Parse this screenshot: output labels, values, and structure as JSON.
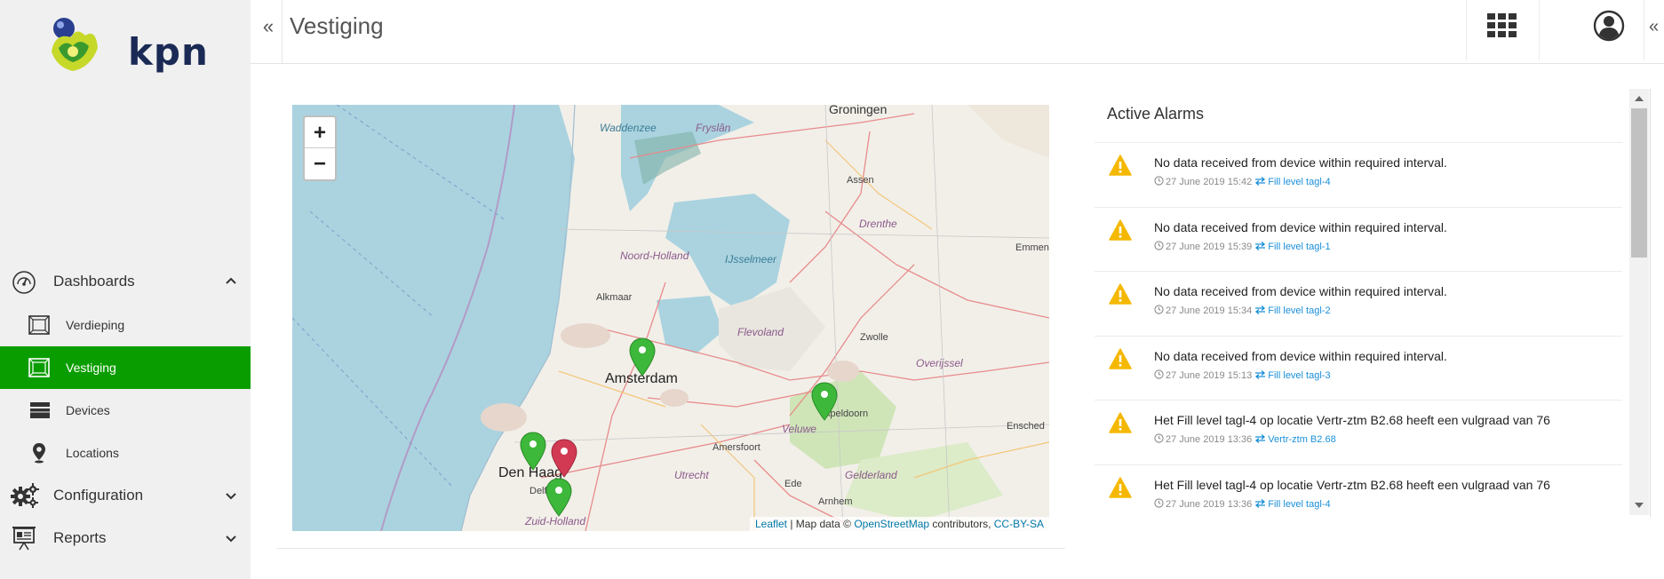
{
  "brand": {
    "name": "kpn",
    "accent": "#0a9d00",
    "dark": "#1b2a55"
  },
  "sidebar": {
    "sections": [
      {
        "label": "Dashboards",
        "icon": "speedometer-icon",
        "expanded": true
      },
      {
        "label": "Configuration",
        "icon": "gears-icon",
        "expanded": false
      },
      {
        "label": "Reports",
        "icon": "presentation-icon",
        "expanded": false
      }
    ],
    "dashboard_items": [
      {
        "label": "Verdieping",
        "icon": "floorplan-icon",
        "active": false
      },
      {
        "label": "Vestiging",
        "icon": "floorplan-icon",
        "active": true
      },
      {
        "label": "Devices",
        "icon": "devices-icon",
        "active": false
      },
      {
        "label": "Locations",
        "icon": "location-pin-icon",
        "active": false
      }
    ]
  },
  "header": {
    "title": "Vestiging",
    "collapse_left": "«",
    "collapse_right": "«",
    "apps_icon": "apps-grid-icon",
    "user_icon": "user-circle-icon"
  },
  "map": {
    "zoom_in": "+",
    "zoom_out": "−",
    "attribution": {
      "leaflet": "Leaflet",
      "sep": " | Map data © ",
      "osm": "OpenStreetMap",
      "contrib": " contributors, ",
      "license": "CC-BY-SA"
    },
    "labels": {
      "groningen": "Groningen",
      "waddenzee": "Waddenzee",
      "fryslan": "Fryslân",
      "assen": "Assen",
      "drenthe": "Drenthe",
      "emmen": "Emmen",
      "noord_holland": "Noord-Holland",
      "ijsselmeer": "IJsselmeer",
      "alkmaar": "Alkmaar",
      "flevoland": "Flevoland",
      "zwolle": "Zwolle",
      "overijssel": "Overijssel",
      "amsterdam": "Amsterdam",
      "apeldoorn": "Apeldoorn",
      "veluwe": "Veluwe",
      "enschede": "Ensched",
      "amersfoort": "Amersfoort",
      "den_haag": "Den Haag",
      "delft": "Delft",
      "utrecht": "Utrecht",
      "ede": "Ede",
      "gelderland": "Gelderland",
      "arnhem": "Arnhem",
      "zuid_holland": "Zuid-Holland"
    },
    "marker_colors": {
      "ok": "#3db83a",
      "alarm": "#d23a53"
    }
  },
  "alarms": {
    "title": "Active Alarms",
    "items": [
      {
        "message": "No data received from device within required interval.",
        "time": "27 June 2019 15:42",
        "link": "Fill level tagl-4"
      },
      {
        "message": "No data received from device within required interval.",
        "time": "27 June 2019 15:39",
        "link": "Fill level tagl-1"
      },
      {
        "message": "No data received from device within required interval.",
        "time": "27 June 2019 15:34",
        "link": "Fill level tagl-2"
      },
      {
        "message": "No data received from device within required interval.",
        "time": "27 June 2019 15:13",
        "link": "Fill level tagl-3"
      },
      {
        "message": "Het Fill level tagl-4 op locatie Vertr-ztm B2.68 heeft een vulgraad van 76",
        "time": "27 June 2019 13:36",
        "link": "Vertr-ztm B2.68"
      },
      {
        "message": "Het Fill level tagl-4 op locatie Vertr-ztm B2.68 heeft een vulgraad van 76",
        "time": "27 June 2019 13:36",
        "link": "Fill level tagl-4"
      }
    ]
  }
}
